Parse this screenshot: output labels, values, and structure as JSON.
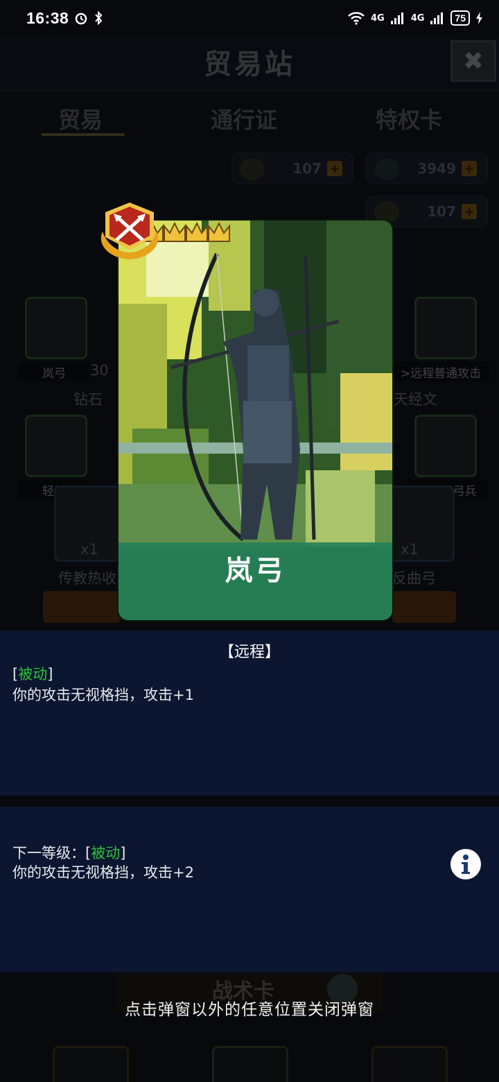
{
  "status_bar": {
    "time": "16:38",
    "signal_left": "4G",
    "signal_right": "4G",
    "battery": "75"
  },
  "background": {
    "title": "贸易站",
    "tabs": [
      "贸易",
      "通行证",
      "特权卡"
    ],
    "resources": [
      {
        "value": "107"
      },
      {
        "value": "3949"
      },
      {
        "value": "107"
      }
    ],
    "items": {
      "item1_label": "岚弓",
      "item1_count": "30",
      "item1_name": "钻石",
      "item2_label": ">远程普通攻击",
      "item2_name": "天经文",
      "item3_label": "轻甲",
      "item4_label": "战意：弓兵",
      "item5_count": "x1",
      "item5_name": "传教热收",
      "item6_count": "x1",
      "item6_name": "反曲弓"
    },
    "tactic_label": "战术卡"
  },
  "card": {
    "name": "岚弓",
    "stars": 5,
    "class_icon": "crossed-arrows-icon"
  },
  "description": {
    "type": "【远程】",
    "current_tag_open": "[",
    "current_tag": "被动",
    "current_tag_close": "]",
    "current_effect": "你的攻击无视格挡，攻击+1",
    "next_prefix": "下一等级：[",
    "next_tag": "被动",
    "next_tag_close": "]",
    "next_effect": "你的攻击无视格挡，攻击+2"
  },
  "hint": "点击弹窗以外的任意位置关闭弹窗",
  "colors": {
    "panel": "#0d1630",
    "card_bar": "#268058",
    "tag_green": "#27c43a"
  }
}
